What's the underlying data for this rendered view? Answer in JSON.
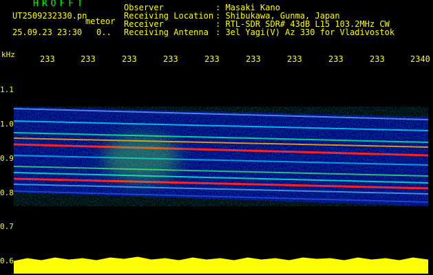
{
  "header": {
    "app_title": "HROFFT",
    "filename": "UT2509232330.pn",
    "meteor_label": "meteor",
    "datetime": "25.09.23 23:30",
    "count": "0.."
  },
  "info": [
    {
      "label": "Observer",
      "value": ": Masaki Kano"
    },
    {
      "label": "Receiving Location",
      "value": ": Shibukawa, Gunma, Japan"
    },
    {
      "label": "Receiver",
      "value": ": RTL-SDR SDR# 43dB L15 103.2MHz CW"
    },
    {
      "label": "Receiving Antenna",
      "value": ": 3el Yagi(V) Az 330 for Vladivostok"
    }
  ],
  "axis": {
    "y_unit": "kHz",
    "y_ticks": [
      "1.1",
      "1.0",
      "0.9",
      "0.8",
      "0.7",
      "0.6"
    ],
    "x_ticks": [
      "233",
      "233",
      "233",
      "233",
      "233",
      "233",
      "233",
      "233",
      "233",
      "2340"
    ]
  },
  "colors": {
    "background": "#000000",
    "text": "#ffff00",
    "title": "#00ff00",
    "noise_low": "#0000a0",
    "noise_mid": "#00ffff",
    "signal_high": "#ff0000",
    "amplitude_bar": "#ffff00"
  }
}
